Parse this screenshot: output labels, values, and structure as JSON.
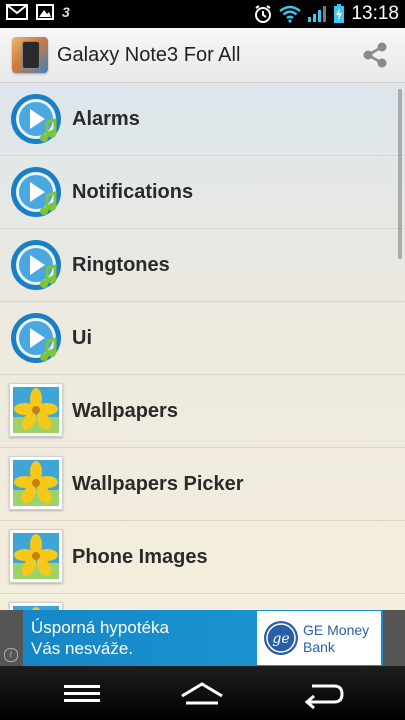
{
  "status_bar": {
    "time": "13:18",
    "left_icons": [
      "gmail-icon",
      "picture-icon",
      "g3-icon"
    ],
    "g3_label": "3",
    "right_icons": [
      "alarm-clock-icon",
      "wifi-icon",
      "signal-icon",
      "battery-charging-icon"
    ]
  },
  "action_bar": {
    "title": "Galaxy Note3 For All",
    "share_icon": "share-icon"
  },
  "list": {
    "items": [
      {
        "label": "Alarms",
        "icon": "audio-play-icon"
      },
      {
        "label": "Notifications",
        "icon": "audio-play-icon"
      },
      {
        "label": "Ringtones",
        "icon": "audio-play-icon"
      },
      {
        "label": "Ui",
        "icon": "audio-play-icon"
      },
      {
        "label": "Wallpapers",
        "icon": "flower-image-icon"
      },
      {
        "label": "Wallpapers Picker",
        "icon": "flower-image-icon"
      },
      {
        "label": "Phone Images",
        "icon": "flower-image-icon"
      }
    ]
  },
  "ad": {
    "line1": "Úsporná hypotéka",
    "line2": "Vás nesváže.",
    "brand_line1": "GE Money",
    "brand_line2": "Bank",
    "info_glyph": "i"
  },
  "nav": {
    "buttons": [
      "menu-icon",
      "home-icon",
      "back-icon"
    ]
  },
  "colors": {
    "action_bar": "#efefef",
    "ad_background": "#1a8ccb",
    "play_icon_blue": "#1a7fc4",
    "note_green": "#7ec43a"
  }
}
